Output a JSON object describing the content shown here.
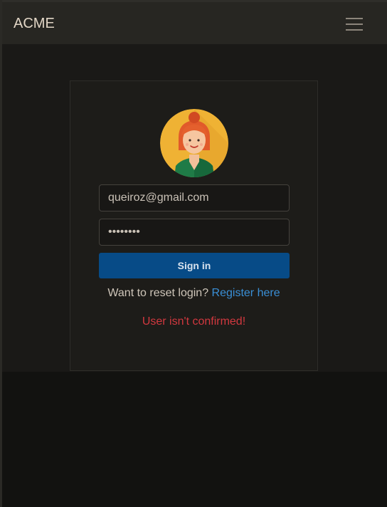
{
  "navbar": {
    "brand": "ACME",
    "menu_icon": "hamburger-menu-icon"
  },
  "login": {
    "avatar_icon": "user-avatar-icon",
    "email_value": "queiroz@gmail.com",
    "password_value": "••••••••",
    "signin_label": "Sign in",
    "reset_prompt": "Want to reset login?",
    "register_link": "Register here",
    "error_message": "User isn't confirmed!"
  },
  "colors": {
    "primary_button": "#074b87",
    "link": "#3a8fd6",
    "error": "#d2383f"
  }
}
